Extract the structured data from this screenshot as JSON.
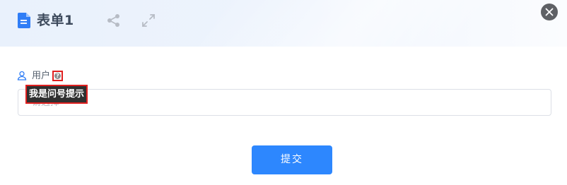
{
  "header": {
    "title": "表单1",
    "icons": [
      "document-icon",
      "share-icon",
      "expand-icon",
      "close-icon"
    ]
  },
  "form": {
    "field": {
      "label": "用户",
      "icon": "user-icon",
      "help_icon": "question-icon",
      "placeholder": "请选择",
      "tooltip": "我是问号提示"
    },
    "submit_label": "提交"
  },
  "colors": {
    "primary": "#2d87fe",
    "header_bg": "#e9f1fc",
    "title_text": "#3d4a5c",
    "close_button": "#5f6165",
    "highlight_border": "#e02020",
    "tooltip_bg": "#2f2f2f"
  }
}
